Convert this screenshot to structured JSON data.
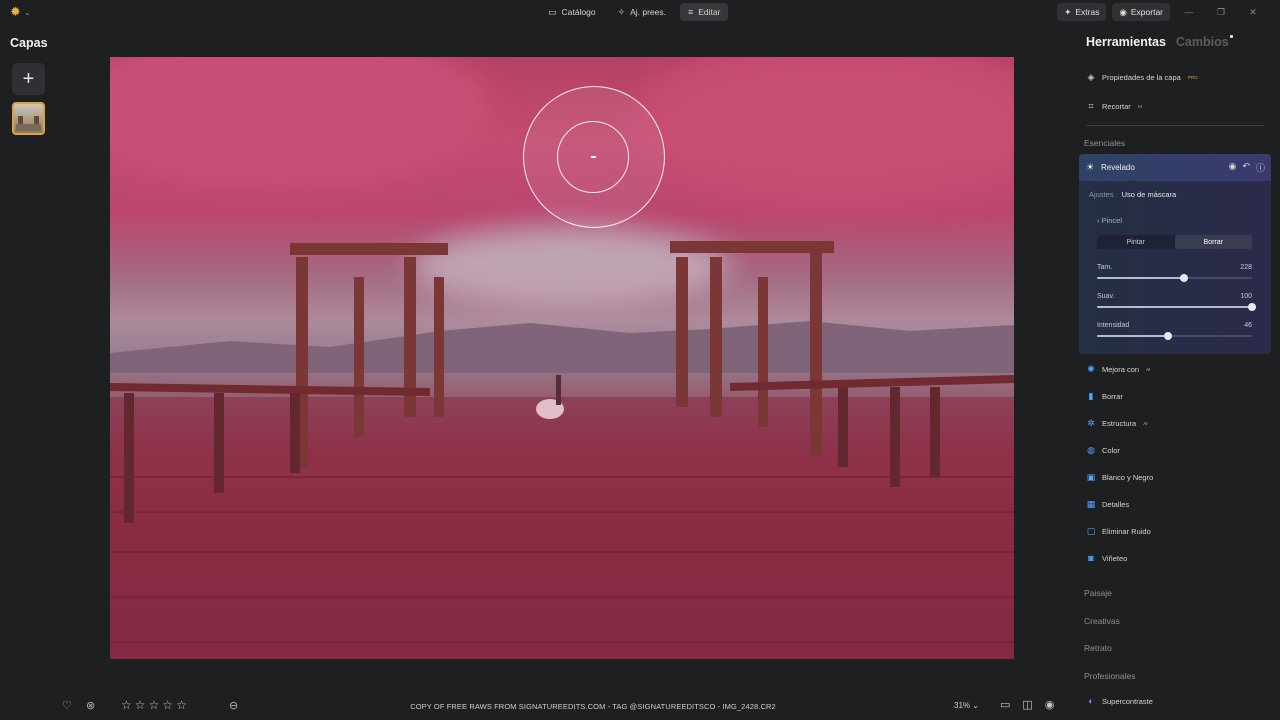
{
  "topbar": {
    "mode_tabs": [
      {
        "label": "Catálogo",
        "icon": "folder-icon"
      },
      {
        "label": "Aj. prees.",
        "icon": "magic-wand-icon"
      },
      {
        "label": "Editar",
        "icon": "sliders-icon"
      }
    ],
    "extras_label": "Extras",
    "export_label": "Exportar"
  },
  "layers": {
    "title": "Capas"
  },
  "bottombar": {
    "caption": "COPY OF FREE RAWS FROM SIGNATUREEDITS.COM - TAG @SIGNATUREEDITSCO - IMG_2428.CR2",
    "zoom": "31% ⌄",
    "rating": 0,
    "stars_total": 5
  },
  "right_panel": {
    "tabs": {
      "tools": "Herramientas",
      "changes": "Cambios"
    },
    "top_tools": [
      {
        "label": "Propiedades de la capa",
        "badge": "PRO",
        "icon": "layers-icon"
      },
      {
        "label": "Recortar",
        "badge": "AI",
        "icon": "crop-icon"
      }
    ],
    "sections": {
      "essentials": "Esenciales",
      "landscape": "Paisaje",
      "creative": "Creativas",
      "portrait": "Retrato",
      "professional": "Profesionales"
    },
    "revelado": {
      "title": "Revelado",
      "subtabs": [
        "Ajustes",
        "Uso de máscara"
      ],
      "brush_label": "Pincel",
      "segment": [
        "Pintar",
        "Borrar"
      ],
      "sliders": [
        {
          "label": "Tam.",
          "value": "228",
          "fraction": 0.56
        },
        {
          "label": "Suav.",
          "value": "100",
          "fraction": 1.0
        },
        {
          "label": "Intensidad",
          "value": "46",
          "fraction": 0.46
        }
      ]
    },
    "essential_tools": [
      {
        "label": "Mejora con",
        "badge": "AI",
        "icon": "sparkle-icon"
      },
      {
        "label": "Borrar",
        "badge": "",
        "icon": "eraser-icon"
      },
      {
        "label": "Estructura",
        "badge": "AI",
        "icon": "structure-icon"
      },
      {
        "label": "Color",
        "badge": "",
        "icon": "color-icon"
      },
      {
        "label": "Blanco y Negro",
        "badge": "",
        "icon": "bw-icon"
      },
      {
        "label": "Detalles",
        "badge": "",
        "icon": "details-icon"
      },
      {
        "label": "Eliminar Ruido",
        "badge": "",
        "icon": "denoise-icon"
      },
      {
        "label": "Viñeteo",
        "badge": "",
        "icon": "vignette-icon"
      }
    ],
    "pro_tools": [
      {
        "label": "Supercontraste",
        "badge": "",
        "icon": "contrast-icon"
      }
    ]
  },
  "colors": {
    "accent": "#d9a441",
    "panel_bg": "#1e1f21",
    "tool_icon_blue": "#54a7ff",
    "mask_red": "#c8284a"
  }
}
